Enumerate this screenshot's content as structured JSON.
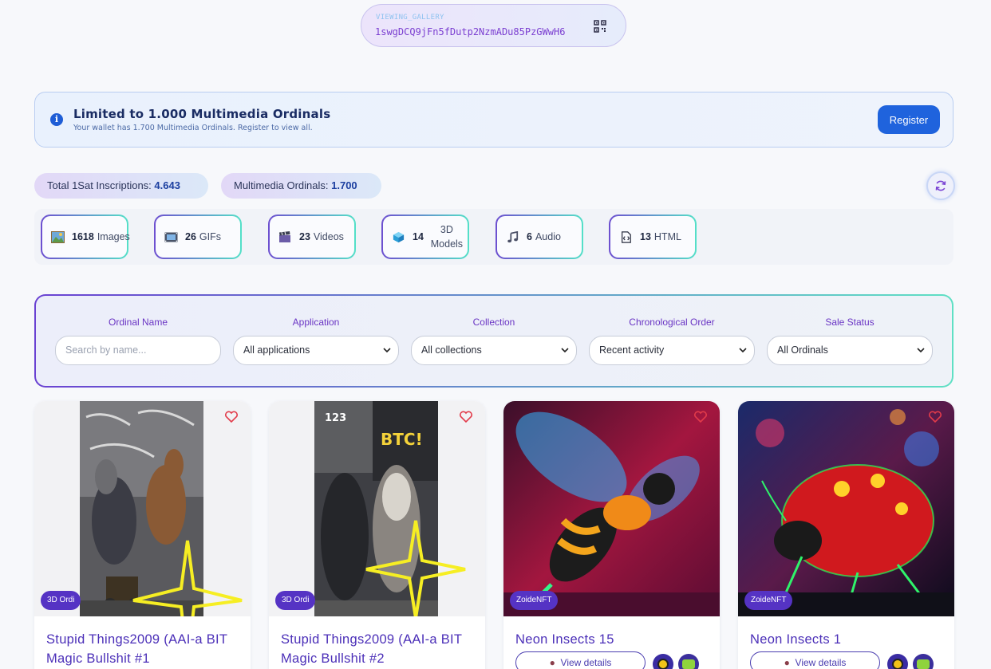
{
  "wallet": {
    "label": "VIEWING_GALLERY",
    "address": "1swgDCQ9jFn5fDutp2NzmADu85PzGWwH6",
    "qr_icon": "qr-code-icon"
  },
  "banner": {
    "icon": "info-icon",
    "title": "Limited to 1.000 Multimedia Ordinals",
    "subtitle": "Your wallet has 1.700 Multimedia Ordinals. Register to view all.",
    "register_label": "Register"
  },
  "stats": {
    "total_label": "Total 1Sat Inscriptions:",
    "total_value": "4.643",
    "multimedia_label": "Multimedia Ordinals:",
    "multimedia_value": "1.700",
    "refresh_icon": "refresh-icon"
  },
  "media_types": [
    {
      "count": "1618",
      "label": "Images",
      "icon": "image-icon"
    },
    {
      "count": "26",
      "label": "GIFs",
      "icon": "film-icon"
    },
    {
      "count": "23",
      "label": "Videos",
      "icon": "clapper-icon"
    },
    {
      "count": "14",
      "label": "3D Models",
      "icon": "cube-icon"
    },
    {
      "count": "6",
      "label": "Audio",
      "icon": "music-icon"
    },
    {
      "count": "13",
      "label": "HTML",
      "icon": "code-file-icon"
    }
  ],
  "filters": {
    "name_label": "Ordinal Name",
    "name_placeholder": "Search by name...",
    "application_label": "Application",
    "application_value": "All applications",
    "collection_label": "Collection",
    "collection_value": "All collections",
    "order_label": "Chronological Order",
    "order_value": "Recent activity",
    "sale_label": "Sale Status",
    "sale_value": "All Ordinals"
  },
  "cards": [
    {
      "badge": "3D Ordi",
      "title": "Stupid Things2009 (AAI-a BIT Magic Bullshit #1"
    },
    {
      "badge": "3D Ordi",
      "title": "Stupid Things2009 (AAI-a BIT Magic Bullshit #2"
    },
    {
      "badge": "ZoideNFT",
      "title": "Neon Insects 15",
      "details_label": "View details"
    },
    {
      "badge": "ZoideNFT",
      "title": "Neon Insects 1",
      "details_label": "View details"
    }
  ],
  "colors": {
    "accent": "#1f63dd",
    "purple": "#5533c4",
    "teal": "#54e0c8"
  }
}
